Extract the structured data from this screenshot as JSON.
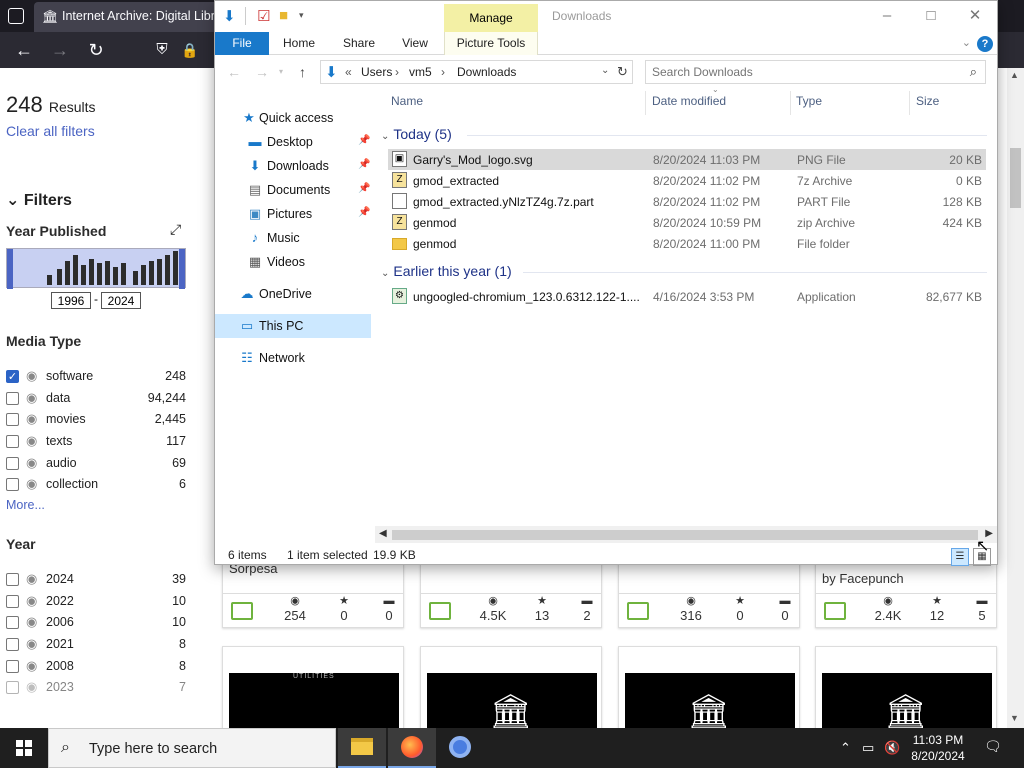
{
  "browser": {
    "tab_title": "Internet Archive: Digital Libra",
    "tab_favicon": "archive-icon"
  },
  "sidebar": {
    "results_count": "248",
    "results_label": "Results",
    "clear_filters": "Clear all filters",
    "filters_heading": "Filters",
    "year_published_heading": "Year Published",
    "year_from": "1996",
    "year_to": "2024",
    "year_dash": "-",
    "media_type_heading": "Media Type",
    "media_types": [
      {
        "label": "software",
        "count": "248",
        "checked": true
      },
      {
        "label": "data",
        "count": "94,244",
        "checked": false
      },
      {
        "label": "movies",
        "count": "2,445",
        "checked": false
      },
      {
        "label": "texts",
        "count": "117",
        "checked": false
      },
      {
        "label": "audio",
        "count": "69",
        "checked": false
      },
      {
        "label": "collection",
        "count": "6",
        "checked": false
      }
    ],
    "more_label": "More...",
    "year_heading": "Year",
    "years": [
      {
        "label": "2024",
        "count": "39"
      },
      {
        "label": "2022",
        "count": "10"
      },
      {
        "label": "2006",
        "count": "10"
      },
      {
        "label": "2021",
        "count": "8"
      },
      {
        "label": "2008",
        "count": "8"
      },
      {
        "label": "2023",
        "count": "7"
      }
    ]
  },
  "cards_row1": [
    {
      "byline": "Sorpesa",
      "views": "254",
      "favs": "0",
      "reviews": "0"
    },
    {
      "byline": "",
      "views": "4.5K",
      "favs": "13",
      "reviews": "2"
    },
    {
      "byline": "",
      "views": "316",
      "favs": "0",
      "reviews": "0"
    },
    {
      "byline": "by Facepunch",
      "views": "2.4K",
      "favs": "12",
      "reviews": "5"
    }
  ],
  "card_thumb_text": "UTILITIES",
  "explorer": {
    "title": "Downloads",
    "manage_tab": "Manage",
    "ribbon_tabs": [
      "File",
      "Home",
      "Share",
      "View",
      "Picture Tools"
    ],
    "help": "?",
    "address_prefix": "«",
    "breadcrumb": [
      "Users",
      "vm5",
      "Downloads"
    ],
    "search_placeholder": "Search Downloads",
    "nav_items": [
      {
        "label": "Quick access",
        "icon": "star-icon"
      },
      {
        "label": "Desktop",
        "icon": "desktop-icon",
        "pinned": true
      },
      {
        "label": "Downloads",
        "icon": "download-icon",
        "pinned": true
      },
      {
        "label": "Documents",
        "icon": "documents-icon",
        "pinned": true
      },
      {
        "label": "Pictures",
        "icon": "pictures-icon",
        "pinned": true
      },
      {
        "label": "Music",
        "icon": "music-icon"
      },
      {
        "label": "Videos",
        "icon": "videos-icon"
      },
      {
        "label": "OneDrive",
        "icon": "cloud-icon"
      },
      {
        "label": "This PC",
        "icon": "computer-icon"
      },
      {
        "label": "Network",
        "icon": "network-icon"
      }
    ],
    "columns": [
      "Name",
      "Date modified",
      "Type",
      "Size"
    ],
    "groups": [
      {
        "label": "Today (5)"
      },
      {
        "label": "Earlier this year (1)"
      }
    ],
    "files": [
      {
        "name": "Garry's_Mod_logo.svg",
        "date": "8/20/2024 11:03 PM",
        "type": "PNG File",
        "size": "20 KB",
        "icon": "image-file-icon",
        "selected": true
      },
      {
        "name": "gmod_extracted",
        "date": "8/20/2024 11:02 PM",
        "type": "7z Archive",
        "size": "0 KB",
        "icon": "archive-file-icon"
      },
      {
        "name": "gmod_extracted.yNlzTZ4g.7z.part",
        "date": "8/20/2024 11:02 PM",
        "type": "PART File",
        "size": "128 KB",
        "icon": "blank-file-icon"
      },
      {
        "name": "genmod",
        "date": "8/20/2024 10:59 PM",
        "type": "zip Archive",
        "size": "424 KB",
        "icon": "zip-file-icon"
      },
      {
        "name": "genmod",
        "date": "8/20/2024 11:00 PM",
        "type": "File folder",
        "size": "",
        "icon": "folder-icon"
      },
      {
        "name": "ungoogled-chromium_123.0.6312.122-1....",
        "date": "4/16/2024 3:53 PM",
        "type": "Application",
        "size": "82,677 KB",
        "icon": "application-icon"
      }
    ],
    "status_items": "6 items",
    "status_selected": "1 item selected",
    "status_size": "19.9 KB"
  },
  "taskbar": {
    "search_placeholder": "Type here to search",
    "time": "11:03 PM",
    "date": "8/20/2024",
    "accent": "#7aa7e8"
  }
}
